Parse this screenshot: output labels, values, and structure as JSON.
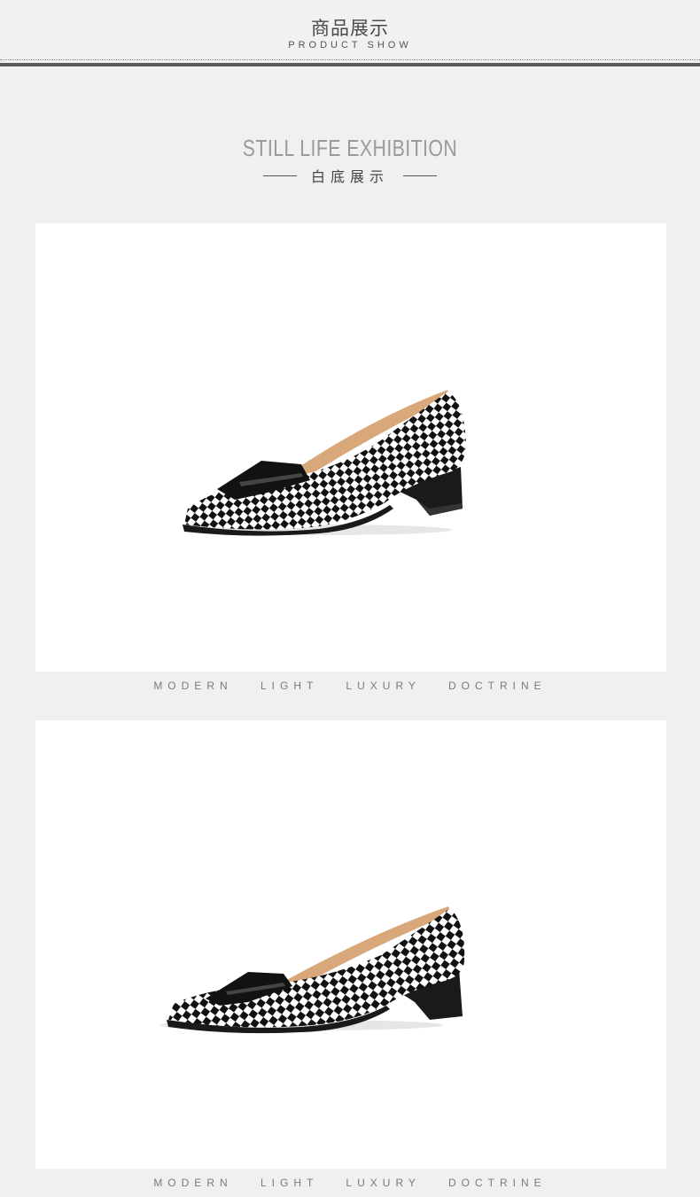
{
  "header": {
    "title": "商品展示",
    "subtitle": "PRODUCT SHOW"
  },
  "section": {
    "title": "STILL LIFE  EXHIBITION",
    "subtitle": "白底展示"
  },
  "photos": [
    {
      "caption": "MODERN   LIGHT   LUXURY DOCTRINE"
    },
    {
      "caption": "MODERN   LIGHT   LUXURY DOCTRINE"
    }
  ],
  "colors": {
    "page_background": "#f0f0f0",
    "photo_background": "#ffffff",
    "check_dark": "#111111",
    "check_light": "#ffffff",
    "lining": "#d9a87a"
  },
  "icons": [
    "shoe-product-image",
    "shoe-product-image"
  ]
}
